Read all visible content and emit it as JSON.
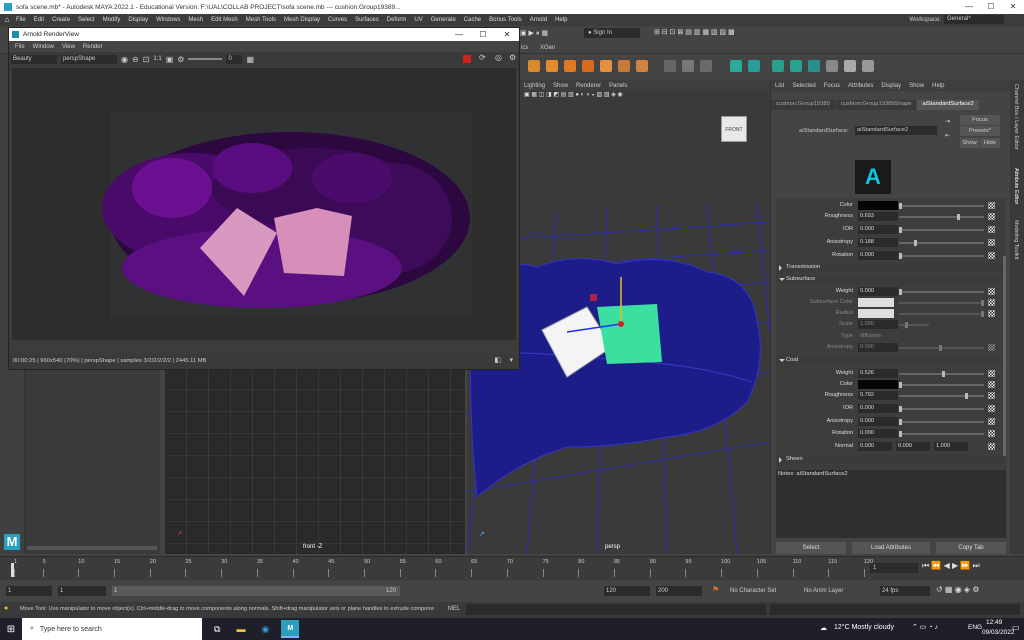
{
  "window": {
    "title": "sofa scene.mb* - Autodesk MAYA 2022.1 - Educational Version: F:\\UAL\\COLLAB PROJECT\\sofa scene.mb  ---  cushion:Group19389...",
    "controls": [
      "—",
      "☐",
      "✕"
    ]
  },
  "menubar": {
    "items": [
      "File",
      "Edit",
      "Create",
      "Select",
      "Modify",
      "Display",
      "Windows",
      "Mesh",
      "Edit Mesh",
      "Mesh Tools",
      "Mesh Display",
      "Curves",
      "Surfaces",
      "Deform",
      "UV",
      "Generate",
      "Cache",
      "Bonus Tools",
      "Arnold",
      "Help"
    ],
    "workspace_label": "Workspace:",
    "workspace_value": "General*"
  },
  "shelf": {
    "sign_in": "Sign In",
    "tab_xgen": "XGen",
    "tab_partial": "ics"
  },
  "renderview": {
    "title": "Arnold RenderView",
    "menu": [
      "File",
      "Window",
      "View",
      "Render"
    ],
    "aov": "Beauty",
    "camera": "perspShape",
    "ratio": "1:1",
    "exposure": "0",
    "status": "00:00:25 | 960x540 (70%) | perspShape  | samples 3/2/2/2/2/2 | 2445.11 MB"
  },
  "viewport": {
    "menu": [
      "Lighting",
      "Show",
      "Renderer",
      "Panels"
    ],
    "ortho_label": "front -Z",
    "persp_label": "persp",
    "viewcube_label": "FRONT"
  },
  "attribute_editor": {
    "menu": [
      "List",
      "Selected",
      "Focus",
      "Attributes",
      "Display",
      "Show",
      "Help"
    ],
    "tabs": [
      "cushion:Group19389",
      "cushion:Group19389Shape",
      "aiStandardSurface2"
    ],
    "node_label": "aiStandardSurface:",
    "node_value": "aiStandardSurface2",
    "focus_btn": "Focus",
    "presets_btn": "Presets*",
    "show_btn": "Show",
    "hide_btn": "Hide",
    "rows_top": [
      {
        "label": "Color",
        "value": ""
      },
      {
        "label": "Roughness",
        "value": "0.693"
      },
      {
        "label": "IOR",
        "value": "0.000"
      },
      {
        "label": "Anisotropy",
        "value": "0.188"
      },
      {
        "label": "Rotation",
        "value": "0.000"
      }
    ],
    "section_transmission": "Transmission",
    "section_subsurface": "Subsurface",
    "subsurface_rows": [
      {
        "label": "Weight",
        "value": "0.000"
      },
      {
        "label": "Subsurface Color",
        "value": ""
      },
      {
        "label": "Radius",
        "value": ""
      },
      {
        "label": "Scale",
        "value": "1.000"
      },
      {
        "label": "Type",
        "value": "diffusion"
      },
      {
        "label": "Anisotropy",
        "value": "0.000"
      }
    ],
    "section_coat": "Coat",
    "coat_rows": [
      {
        "label": "Weight",
        "value": "0.526"
      },
      {
        "label": "Color",
        "value": ""
      },
      {
        "label": "Roughness",
        "value": "0.792"
      },
      {
        "label": "IOR",
        "value": "0.000"
      },
      {
        "label": "Anisotropy",
        "value": "0.000"
      },
      {
        "label": "Rotation",
        "value": "0.000"
      }
    ],
    "normal_label": "Normal",
    "normal_values": [
      "0.000",
      "0.000",
      "1.000"
    ],
    "section_sheen": "Sheen",
    "notes": "Notes: aiStandardSurface2",
    "btn_select": "Select",
    "btn_load": "Load Attributes",
    "btn_copy": "Copy Tab",
    "side_tabs": [
      "Channel Box / Layer Editor",
      "Attribute Editor",
      "Modeling Toolkit"
    ]
  },
  "timeline": {
    "ticks": [
      "1",
      "5",
      "10",
      "15",
      "20",
      "25",
      "30",
      "35",
      "40",
      "45",
      "50",
      "55",
      "60",
      "65",
      "70",
      "75",
      "80",
      "85",
      "90",
      "95",
      "100",
      "105",
      "110",
      "115",
      "120"
    ],
    "current_frame": "1",
    "range_start": "1",
    "range_start2": "1",
    "range_inner_start": "1",
    "range_inner_end": "120",
    "range_end": "120",
    "range_end2": "200",
    "character_set": "No Character Set",
    "anim_layer": "No Anim Layer",
    "fps": "24 fps"
  },
  "commandline": {
    "help": "Move Tool: Use manipulator to move object(s). Ctrl+middle-drag to move components along normals. Shift+drag manipulator axis or plane handles to extrude components or c",
    "mel": "MEL"
  },
  "taskbar": {
    "search": "Type here to search",
    "weather": "12°C  Mostly cloudy",
    "lang": "ENG",
    "time": "12:49",
    "date": "09/03/2022"
  }
}
